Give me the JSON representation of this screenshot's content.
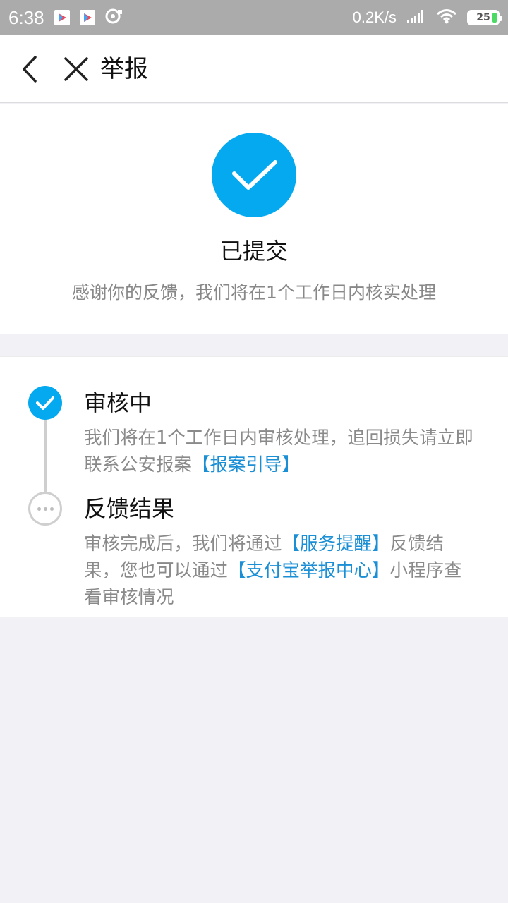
{
  "status_bar": {
    "time": "6:38",
    "network_speed": "0.2K/s",
    "battery": "25"
  },
  "nav": {
    "title": "举报"
  },
  "result": {
    "title": "已提交",
    "description": "感谢你的反馈，我们将在1个工作日内核实处理",
    "accent_color": "#05a9ef"
  },
  "timeline": {
    "steps": [
      {
        "title": "审核中",
        "status": "done",
        "desc_text": "我们将在1个工作日内审核处理，追回损失请立即联系公安报案",
        "link": "【报案引导】"
      },
      {
        "title": "反馈结果",
        "status": "pending",
        "desc_part1": "审核完成后，我们将通过",
        "link1": "【服务提醒】",
        "desc_part2": "反馈结果，您也可以通过",
        "link2": "【支付宝举报中心】",
        "desc_part3": "小程序查看审核情况"
      }
    ],
    "link_color": "#1a8fd6"
  }
}
